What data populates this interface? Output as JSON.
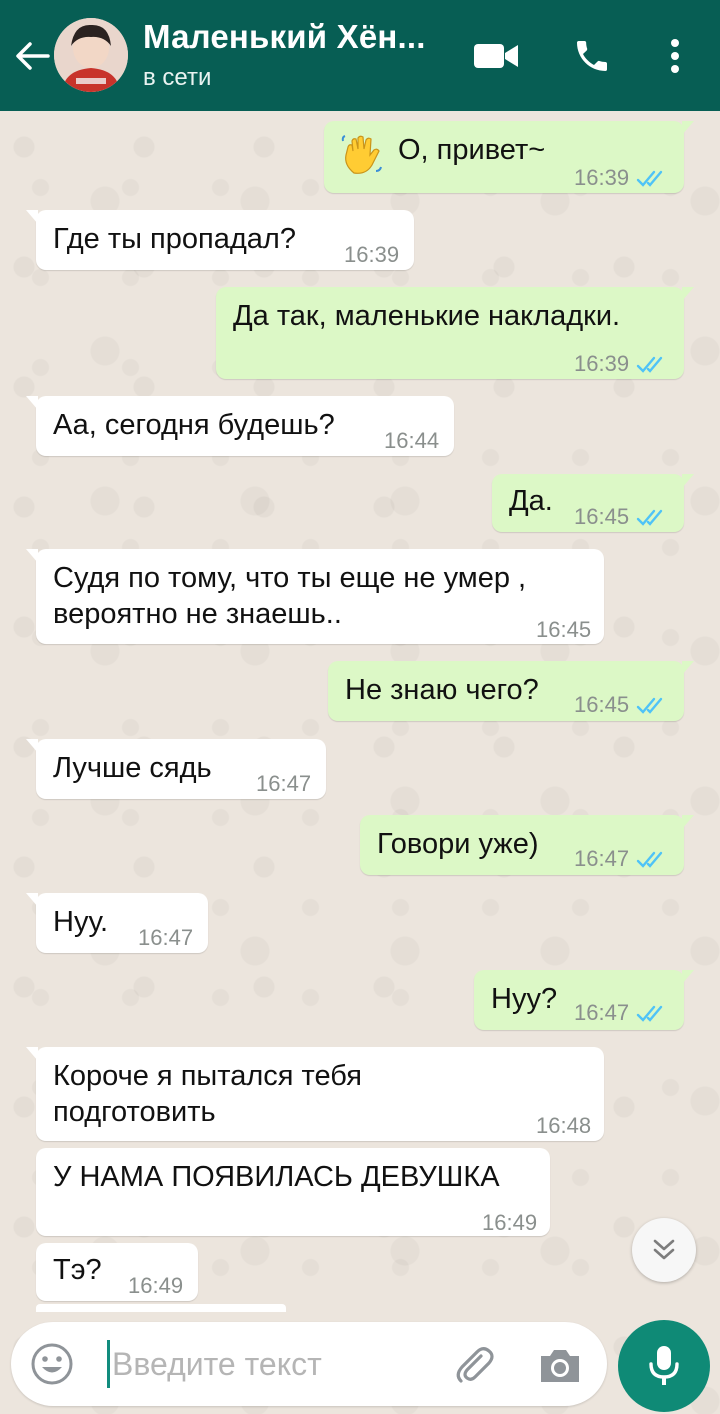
{
  "header": {
    "contact_name": "Маленький Хён...",
    "status": "в сети"
  },
  "messages": [
    {
      "dir": "out",
      "text": "О, привет~",
      "emoji": "waving-hand",
      "time": "16:39",
      "ticks": "read"
    },
    {
      "dir": "in",
      "text": "Где ты пропадал?",
      "time": "16:39"
    },
    {
      "dir": "out",
      "text": "Да так, маленькие накладки.",
      "time": "16:39",
      "ticks": "read"
    },
    {
      "dir": "in",
      "text": "Аа, сегодня будешь?",
      "time": "16:44"
    },
    {
      "dir": "out",
      "text": "Да.",
      "time": "16:45",
      "ticks": "read"
    },
    {
      "dir": "in",
      "lines": [
        "Судя по тому, что ты еще не умер ,",
        "вероятно не знаешь.."
      ],
      "time": "16:45"
    },
    {
      "dir": "out",
      "text": "Не знаю чего?",
      "time": "16:45",
      "ticks": "read"
    },
    {
      "dir": "in",
      "text": "Лучше сядь",
      "time": "16:47"
    },
    {
      "dir": "out",
      "text": "Говори уже)",
      "time": "16:47",
      "ticks": "read"
    },
    {
      "dir": "in",
      "text": "Нуу.",
      "time": "16:47"
    },
    {
      "dir": "out",
      "text": "Нуу?",
      "time": "16:47",
      "ticks": "read"
    },
    {
      "dir": "in",
      "lines": [
        "Короче я пытался тебя",
        "подготовить"
      ],
      "time": "16:48"
    },
    {
      "dir": "in",
      "text": "У НАМА ПОЯВИЛАСЬ ДЕВУШКА",
      "time": "16:49"
    },
    {
      "dir": "in",
      "text": "Тэ?",
      "time": "16:49"
    }
  ],
  "composer": {
    "placeholder": "Введите текст"
  },
  "colors": {
    "header": "#075e54",
    "outgoing_bubble": "#dcf8c6",
    "incoming_bubble": "#ffffff",
    "read_ticks": "#4fc3f7",
    "mic_button": "#0f8a76"
  },
  "icons": [
    "back-arrow-icon",
    "avatar",
    "video-call-icon",
    "phone-icon",
    "more-vert-icon",
    "waving-hand-emoji",
    "double-check-icon",
    "scroll-down-icon",
    "emoji-icon",
    "attach-icon",
    "camera-icon",
    "mic-icon"
  ]
}
